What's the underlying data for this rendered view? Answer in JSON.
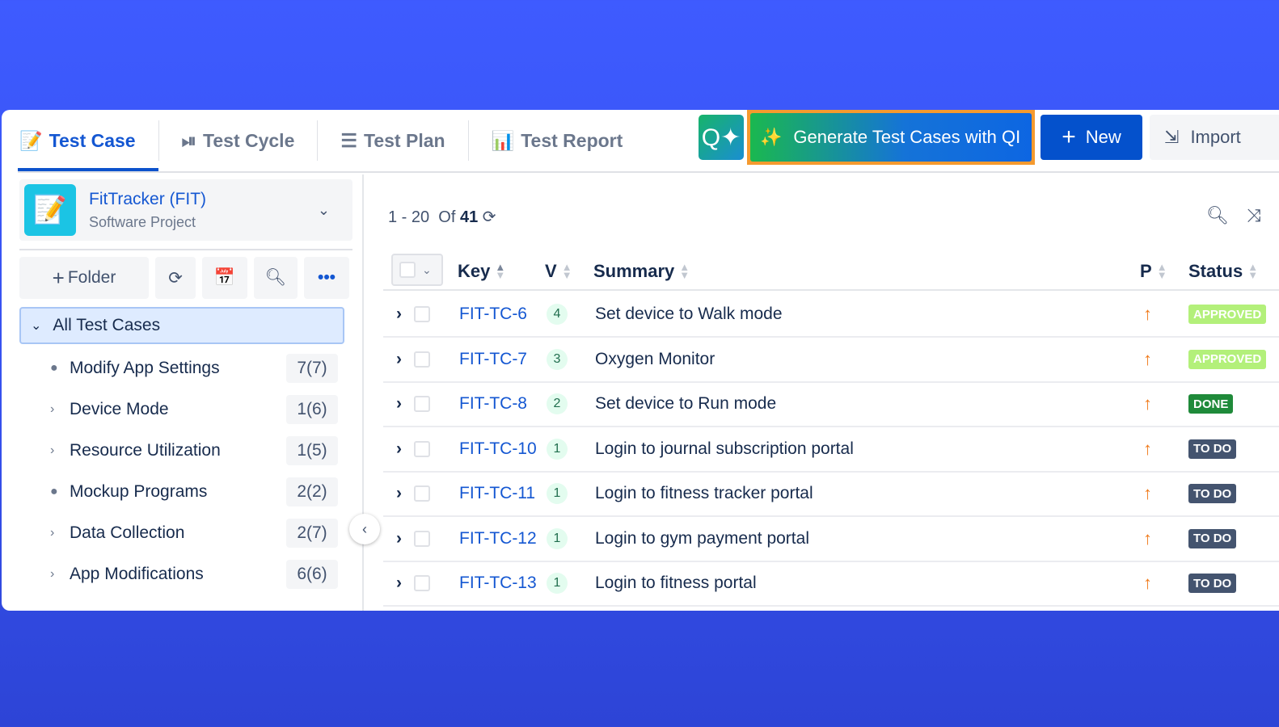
{
  "tabs": [
    {
      "label": "Test Case",
      "icon": "edit-doc-icon"
    },
    {
      "label": "Test Cycle",
      "icon": "play-cycle-icon"
    },
    {
      "label": "Test Plan",
      "icon": "list-doc-icon"
    },
    {
      "label": "Test Report",
      "icon": "bar-chart-icon"
    }
  ],
  "toolbar": {
    "generate_label": "Generate Test Cases with QI",
    "new_label": "New",
    "import_label": "Import"
  },
  "project": {
    "name": "FitTracker (FIT)",
    "type": "Software Project"
  },
  "sidebar": {
    "folder_label": "Folder",
    "root_label": "All Test Cases",
    "folders": [
      {
        "name": "Modify App Settings",
        "count": "7(7)",
        "expandable": false
      },
      {
        "name": "Device Mode",
        "count": "1(6)",
        "expandable": true
      },
      {
        "name": "Resource Utilization",
        "count": "1(5)",
        "expandable": true
      },
      {
        "name": "Mockup Programs",
        "count": "2(2)",
        "expandable": false
      },
      {
        "name": "Data Collection",
        "count": "2(7)",
        "expandable": true
      },
      {
        "name": "App Modifications",
        "count": "6(6)",
        "expandable": true
      }
    ]
  },
  "pager": {
    "range": "1 - 20",
    "of": "Of",
    "total": "41"
  },
  "table": {
    "headers": {
      "key": "Key",
      "version": "V",
      "summary": "Summary",
      "priority": "P",
      "status": "Status"
    },
    "rows": [
      {
        "key": "FIT-TC-6",
        "version": "4",
        "summary": "Set device to Walk mode",
        "status": "APPROVED"
      },
      {
        "key": "FIT-TC-7",
        "version": "3",
        "summary": "Oxygen Monitor",
        "status": "APPROVED"
      },
      {
        "key": "FIT-TC-8",
        "version": "2",
        "summary": "Set device to Run mode",
        "status": "DONE"
      },
      {
        "key": "FIT-TC-10",
        "version": "1",
        "summary": "Login to journal subscription portal",
        "status": "TO DO"
      },
      {
        "key": "FIT-TC-11",
        "version": "1",
        "summary": "Login to fitness tracker portal",
        "status": "TO DO"
      },
      {
        "key": "FIT-TC-12",
        "version": "1",
        "summary": "Login to gym payment portal",
        "status": "TO DO"
      },
      {
        "key": "FIT-TC-13",
        "version": "1",
        "summary": "Login to fitness portal",
        "status": "TO DO"
      }
    ]
  },
  "status_colors": {
    "APPROVED": "#b3f07a",
    "DONE": "#1f8a3a",
    "TO DO": "#44546f"
  }
}
